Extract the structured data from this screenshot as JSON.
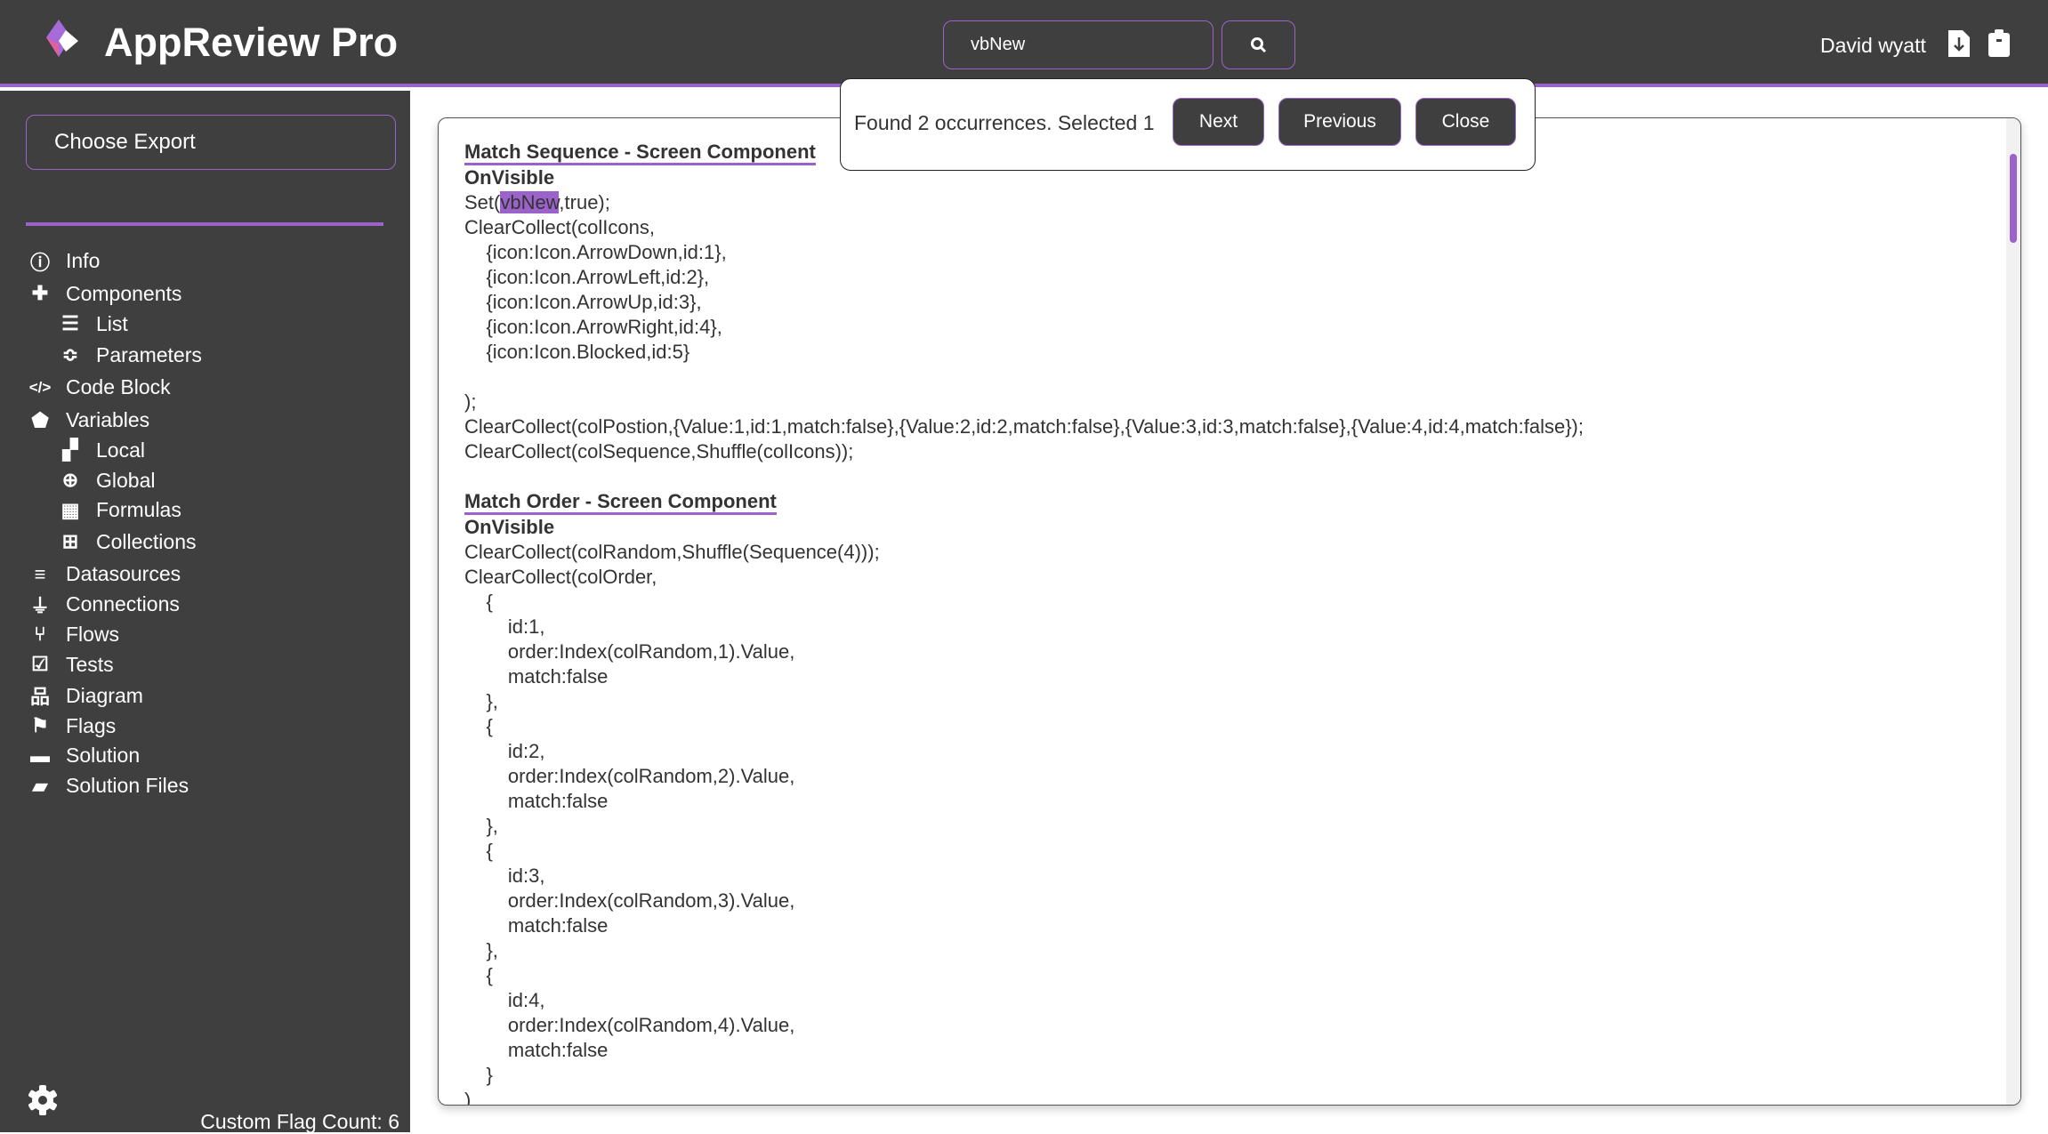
{
  "header": {
    "title": "AppReview Pro",
    "search_value": "vbNew",
    "user_name": "David wyatt",
    "icons": [
      "logo-icon",
      "search-icon",
      "file-download-icon",
      "clipboard-icon"
    ],
    "accent_color": "#9b63c9",
    "background_color": "#3f3f3f"
  },
  "sidebar": {
    "choose_export": "Choose Export",
    "items": [
      {
        "label": "Info",
        "icon": "info-icon",
        "level": 0
      },
      {
        "label": "Components",
        "icon": "puzzle-icon",
        "level": 0
      },
      {
        "label": "List",
        "icon": "list-icon",
        "level": 1
      },
      {
        "label": "Parameters",
        "icon": "sliders-icon",
        "level": 1
      },
      {
        "label": "Code Block",
        "icon": "code-icon",
        "level": 0
      },
      {
        "label": "Variables",
        "icon": "tag-icon",
        "level": 0
      },
      {
        "label": "Local",
        "icon": "boxes-icon",
        "level": 1
      },
      {
        "label": "Global",
        "icon": "globe-icon",
        "level": 1
      },
      {
        "label": "Formulas",
        "icon": "calculator-icon",
        "level": 1
      },
      {
        "label": "Collections",
        "icon": "table-icon",
        "level": 1
      },
      {
        "label": "Datasources",
        "icon": "database-icon",
        "level": 0
      },
      {
        "label": "Connections",
        "icon": "plug-icon",
        "level": 0
      },
      {
        "label": "Flows",
        "icon": "flow-icon",
        "level": 0
      },
      {
        "label": "Tests",
        "icon": "checkbox-icon",
        "level": 0
      },
      {
        "label": "Diagram",
        "icon": "sitemap-icon",
        "level": 0
      },
      {
        "label": "Flags",
        "icon": "flag-icon",
        "level": 0
      },
      {
        "label": "Solution",
        "icon": "box-icon",
        "level": 0
      },
      {
        "label": "Solution Files",
        "icon": "folder-open-icon",
        "level": 0
      }
    ],
    "custom_flag_count": "Custom Flag Count: 6"
  },
  "find": {
    "status": "Found 2 occurrences. Selected 1",
    "next": "Next",
    "previous": "Previous",
    "close": "Close"
  },
  "code": {
    "sections": [
      {
        "title": "Match Sequence - Screen Component",
        "event": "OnVisible",
        "lines": [
          {
            "before": "Set(",
            "match": "vbNew",
            "after": ",true);"
          },
          "ClearCollect(colIcons,",
          "    {icon:Icon.ArrowDown,id:1},",
          "    {icon:Icon.ArrowLeft,id:2},",
          "    {icon:Icon.ArrowUp,id:3},",
          "    {icon:Icon.ArrowRight,id:4},",
          "    {icon:Icon.Blocked,id:5}",
          "",
          ");",
          "ClearCollect(colPostion,{Value:1,id:1,match:false},{Value:2,id:2,match:false},{Value:3,id:3,match:false},{Value:4,id:4,match:false});",
          "ClearCollect(colSequence,Shuffle(colIcons));"
        ]
      },
      {
        "title": "Match Order - Screen Component",
        "event": "OnVisible",
        "lines": [
          "ClearCollect(colRandom,Shuffle(Sequence(4)));",
          "ClearCollect(colOrder,",
          "    {",
          "        id:1,",
          "        order:Index(colRandom,1).Value,",
          "        match:false",
          "    },",
          "    {",
          "        id:2,",
          "        order:Index(colRandom,2).Value,",
          "        match:false",
          "    },",
          "    {",
          "        id:3,",
          "        order:Index(colRandom,3).Value,",
          "        match:false",
          "    },",
          "    {",
          "        id:4,",
          "        order:Index(colRandom,4).Value,",
          "        match:false",
          "    }",
          ")"
        ]
      }
    ]
  }
}
